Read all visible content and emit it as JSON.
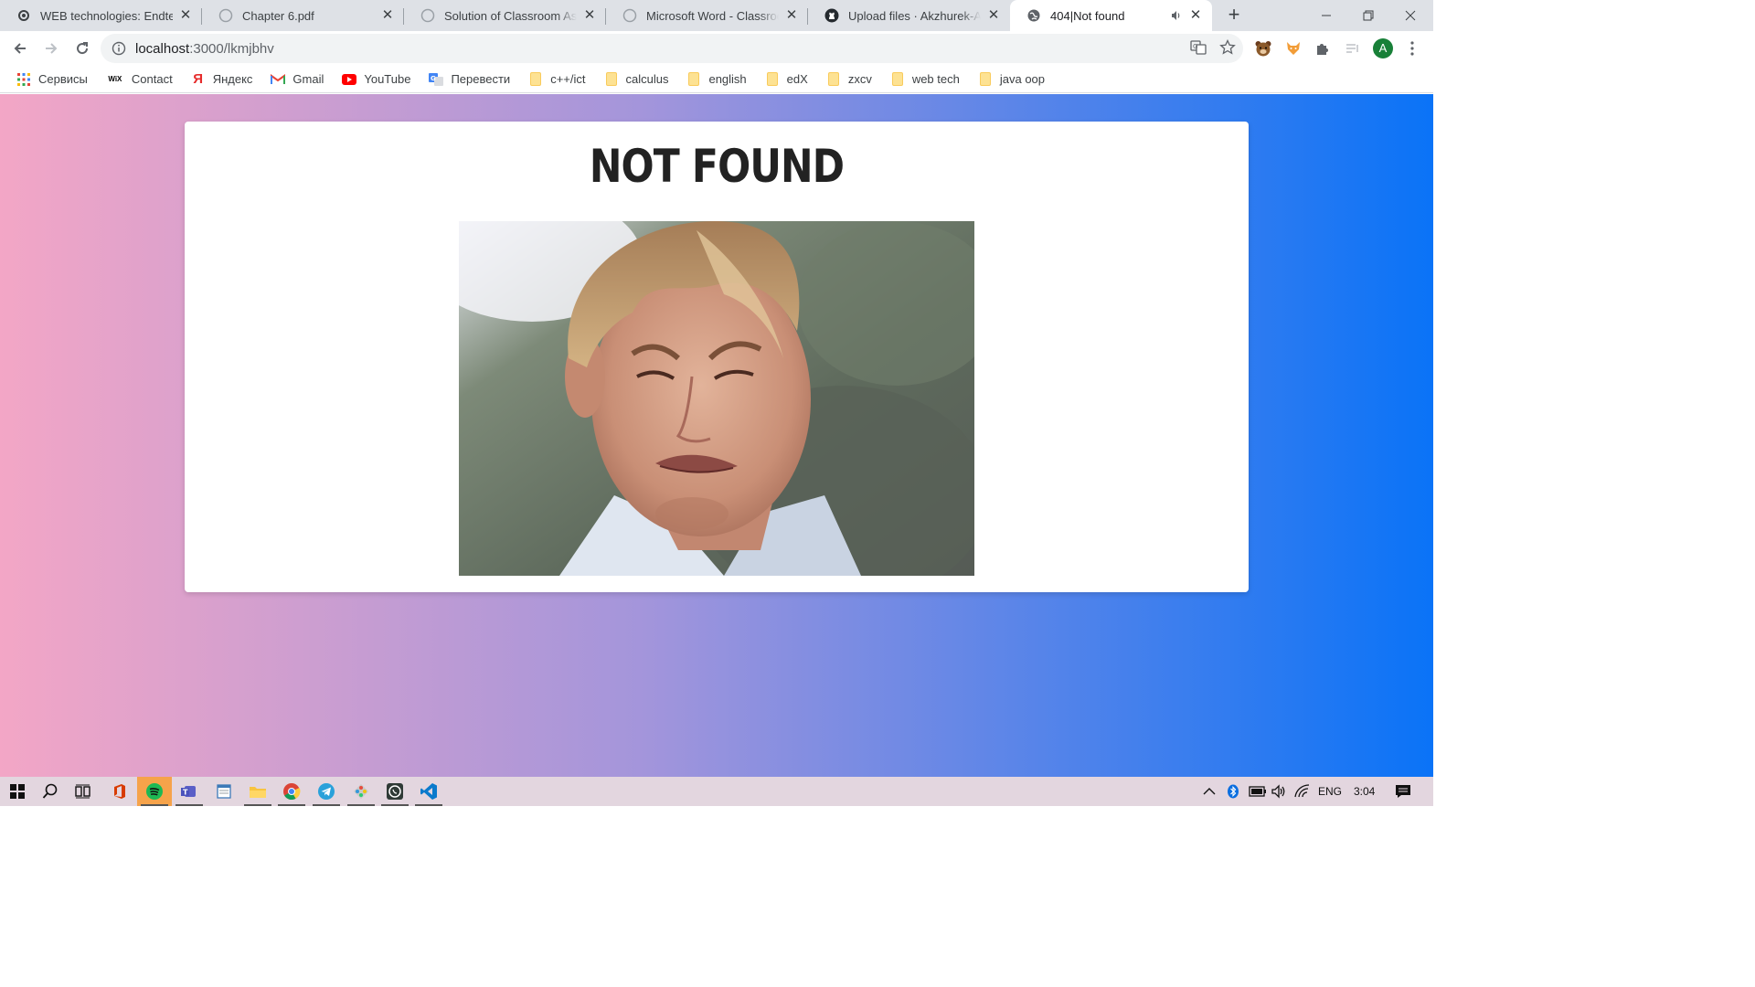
{
  "tabs": [
    {
      "title": "WEB technologies: Endterm",
      "icon": "gear-icon",
      "active": false
    },
    {
      "title": "Chapter 6.pdf",
      "icon": "globe-icon",
      "active": false
    },
    {
      "title": "Solution of Classroom Assign",
      "icon": "globe-icon",
      "active": false
    },
    {
      "title": "Microsoft Word - Classroom",
      "icon": "globe-icon",
      "active": false
    },
    {
      "title": "Upload files · Akzhurek-A/En",
      "icon": "github-icon",
      "active": false
    },
    {
      "title": "404|Not found",
      "icon": "globe-icon",
      "active": true,
      "audio": true
    }
  ],
  "omnibox": {
    "host": "localhost",
    "path": ":3000/lkmjbhv"
  },
  "profile": {
    "initial": "A",
    "color": "#188038"
  },
  "bookmarks": [
    {
      "label": "Сервисы",
      "icon": "apps-grid-icon"
    },
    {
      "label": "Contact",
      "icon": "wix-icon",
      "badge": "WiX"
    },
    {
      "label": "Яндекс",
      "icon": "yandex-icon",
      "badge": "Я"
    },
    {
      "label": "Gmail",
      "icon": "gmail-icon",
      "badge": "M"
    },
    {
      "label": "YouTube",
      "icon": "youtube-icon"
    },
    {
      "label": "Перевести",
      "icon": "translate-icon"
    },
    {
      "label": "c++/ict",
      "icon": "folder-icon"
    },
    {
      "label": "calculus",
      "icon": "folder-icon"
    },
    {
      "label": "english",
      "icon": "folder-icon"
    },
    {
      "label": "edX",
      "icon": "folder-icon"
    },
    {
      "label": "zxcv",
      "icon": "folder-icon"
    },
    {
      "label": "web tech",
      "icon": "folder-icon"
    },
    {
      "label": "java oop",
      "icon": "folder-icon"
    }
  ],
  "page": {
    "heading": "NOT FOUND",
    "gradient": [
      "#f3a6c6",
      "#a395db",
      "#0a73f7"
    ]
  },
  "taskbar": {
    "language": "ENG",
    "time": "3:04"
  }
}
